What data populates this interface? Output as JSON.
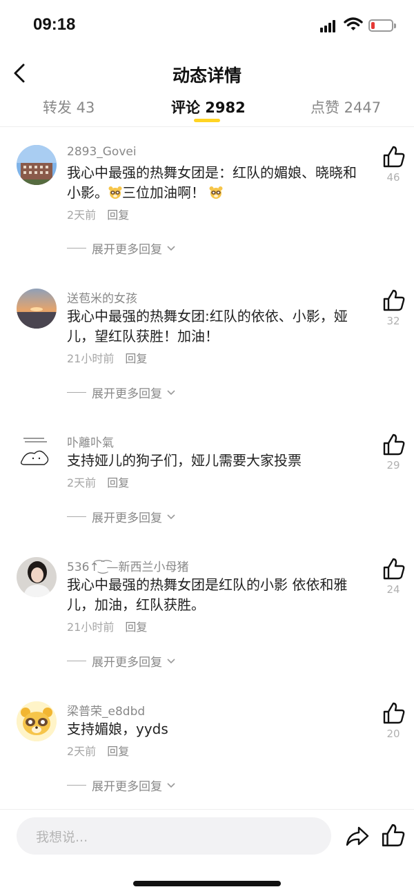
{
  "status_bar": {
    "time": "09:18"
  },
  "nav": {
    "title": "动态详情"
  },
  "tabs": [
    {
      "label": "转发 43",
      "active": false
    },
    {
      "label": "评论 2982",
      "active": true
    },
    {
      "label": "点赞 2447",
      "active": false
    }
  ],
  "comments": [
    {
      "username": "2893_Govei",
      "text_before": "我心中最强的热舞女团是：红队的媚娘、晓晓和小影。",
      "text_mid": "三位加油啊！",
      "time": "2天前",
      "reply_label": "回复",
      "likes": "46",
      "expand_label": "展开更多回复"
    },
    {
      "username": "送苞米的女孩",
      "text": "我心中最强的热舞女团:红队的依依、小影，娅儿，望红队获胜！加油！",
      "time": "21小时前",
      "reply_label": "回复",
      "likes": "32",
      "expand_label": "展开更多回复"
    },
    {
      "username": "卟離卟氣",
      "text": "支持娅儿的狗子们，娅儿需要大家投票",
      "time": "2天前",
      "reply_label": "回复",
      "likes": "29",
      "expand_label": "展开更多回复"
    },
    {
      "username": "536↑͡ ͜ ͡—新西兰小母猪",
      "text": "我心中最强的热舞女团是红队的小影  依依和雅儿，加油，红队获胜。",
      "time": "21小时前",
      "reply_label": "回复",
      "likes": "24",
      "expand_label": "展开更多回复"
    },
    {
      "username": "梁普荣_e8dbd",
      "text": "支持媚娘，yyds",
      "time": "2天前",
      "reply_label": "回复",
      "likes": "20",
      "expand_label": "展开更多回复"
    }
  ],
  "comment_input": {
    "placeholder": "我想说..."
  },
  "colors": {
    "accent": "#ffd423",
    "muted": "#888888",
    "battery_low": "#e53935"
  },
  "icons": [
    "back-arrow-icon",
    "like-thumb-icon",
    "share-icon",
    "chevron-down-icon",
    "raccoon-emoji-icon"
  ]
}
